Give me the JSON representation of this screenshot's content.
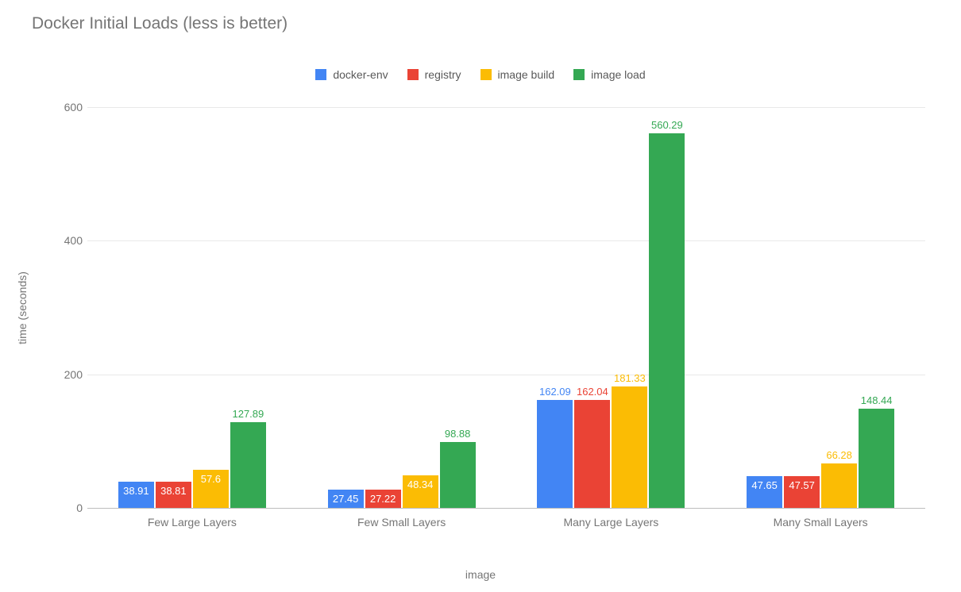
{
  "chart_data": {
    "type": "bar",
    "title": "Docker Initial Loads (less is better)",
    "xlabel": "image",
    "ylabel": "time (seconds)",
    "ylim": [
      0,
      600
    ],
    "yticks": [
      0,
      200,
      400,
      600
    ],
    "categories": [
      "Few Large Layers",
      "Few Small Layers",
      "Many Large Layers",
      "Many Small Layers"
    ],
    "series": [
      {
        "name": "docker-env",
        "color": "#4285F4",
        "values": [
          38.91,
          27.45,
          162.09,
          47.65
        ]
      },
      {
        "name": "registry",
        "color": "#EA4335",
        "values": [
          38.81,
          27.22,
          162.04,
          47.57
        ]
      },
      {
        "name": "image build",
        "color": "#FBBC04",
        "values": [
          57.6,
          48.34,
          181.33,
          66.28
        ]
      },
      {
        "name": "image load",
        "color": "#34A853",
        "values": [
          127.89,
          98.88,
          560.29,
          148.44
        ]
      }
    ],
    "legend_position": "top"
  }
}
